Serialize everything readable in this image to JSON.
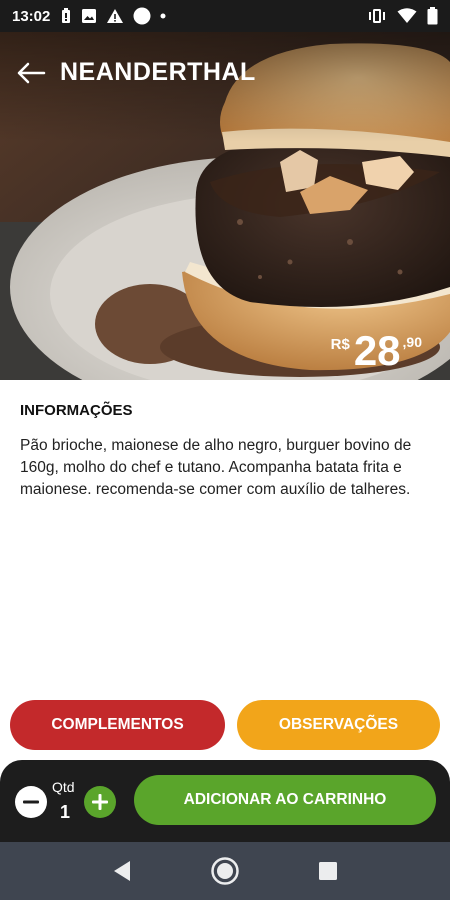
{
  "status_bar": {
    "time": "13:02",
    "left_icons": [
      "battery-saver-icon",
      "image-icon",
      "warning-icon",
      "circle-icon",
      "dot-icon"
    ],
    "right_icons": [
      "vibrate-icon",
      "wifi-icon",
      "battery-icon"
    ]
  },
  "product": {
    "title": "NEANDERTHAL",
    "price_currency": "R$",
    "price_integer": "28",
    "price_decimal": ",90"
  },
  "info": {
    "heading": "INFORMAÇÕES",
    "description": "Pão brioche, maionese de alho negro, burguer bovino de 160g, molho do chef e tutano. Acompanha batata frita e maionese. recomenda-se comer com auxílio de talheres."
  },
  "actions": {
    "complementos_label": "COMPLEMENTOS",
    "observacoes_label": "OBSERVAÇÕES",
    "add_to_cart_label": "ADICIONAR AO CARRINHO"
  },
  "quantity": {
    "label": "Qtd",
    "value": "1"
  },
  "colors": {
    "complementos": "#c3292b",
    "observacoes": "#f2a51a",
    "add_to_cart": "#5aa52b",
    "bottom_bar": "#1d1d1d",
    "nav_bar": "#3f4550"
  },
  "nav_icons": [
    "back-triangle-icon",
    "home-circle-icon",
    "recents-square-icon"
  ]
}
